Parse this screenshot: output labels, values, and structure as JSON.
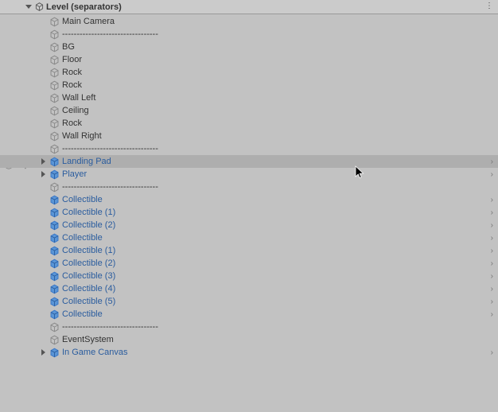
{
  "header": {
    "title": "Level (separators)"
  },
  "colors": {
    "prefab": "#2a5c9e",
    "normal": "#333333"
  },
  "items": [
    {
      "label": "Main Camera",
      "depth": 1,
      "prefab": false,
      "expand": false
    },
    {
      "label": "---------------------------------",
      "depth": 1,
      "prefab": false,
      "expand": false
    },
    {
      "label": "BG",
      "depth": 1,
      "prefab": false,
      "expand": false
    },
    {
      "label": "Floor",
      "depth": 1,
      "prefab": false,
      "expand": false
    },
    {
      "label": "Rock",
      "depth": 1,
      "prefab": false,
      "expand": false
    },
    {
      "label": "Rock",
      "depth": 1,
      "prefab": false,
      "expand": false
    },
    {
      "label": "Wall Left",
      "depth": 1,
      "prefab": false,
      "expand": false
    },
    {
      "label": "Ceiling",
      "depth": 1,
      "prefab": false,
      "expand": false
    },
    {
      "label": "Rock",
      "depth": 1,
      "prefab": false,
      "expand": false
    },
    {
      "label": "Wall Right",
      "depth": 1,
      "prefab": false,
      "expand": false
    },
    {
      "label": "---------------------------------",
      "depth": 1,
      "prefab": false,
      "expand": false
    },
    {
      "label": "Landing Pad",
      "depth": 1,
      "prefab": true,
      "expand": true,
      "children": true,
      "selected": true
    },
    {
      "label": "Player",
      "depth": 1,
      "prefab": true,
      "expand": true,
      "children": true
    },
    {
      "label": "---------------------------------",
      "depth": 1,
      "prefab": false,
      "expand": false
    },
    {
      "label": "Collectible",
      "depth": 1,
      "prefab": true,
      "children": true
    },
    {
      "label": "Collectible (1)",
      "depth": 1,
      "prefab": true,
      "children": true
    },
    {
      "label": "Collectible (2)",
      "depth": 1,
      "prefab": true,
      "children": true
    },
    {
      "label": "Collectible",
      "depth": 1,
      "prefab": true,
      "children": true
    },
    {
      "label": "Collectible (1)",
      "depth": 1,
      "prefab": true,
      "children": true
    },
    {
      "label": "Collectible (2)",
      "depth": 1,
      "prefab": true,
      "children": true
    },
    {
      "label": "Collectible (3)",
      "depth": 1,
      "prefab": true,
      "children": true
    },
    {
      "label": "Collectible (4)",
      "depth": 1,
      "prefab": true,
      "children": true
    },
    {
      "label": "Collectible (5)",
      "depth": 1,
      "prefab": true,
      "children": true
    },
    {
      "label": "Collectible",
      "depth": 1,
      "prefab": true,
      "children": true
    },
    {
      "label": "---------------------------------",
      "depth": 1,
      "prefab": false,
      "expand": false
    },
    {
      "label": "EventSystem",
      "depth": 1,
      "prefab": false,
      "expand": false
    },
    {
      "label": "In Game Canvas",
      "depth": 1,
      "prefab": true,
      "expand": true,
      "children": true
    }
  ]
}
